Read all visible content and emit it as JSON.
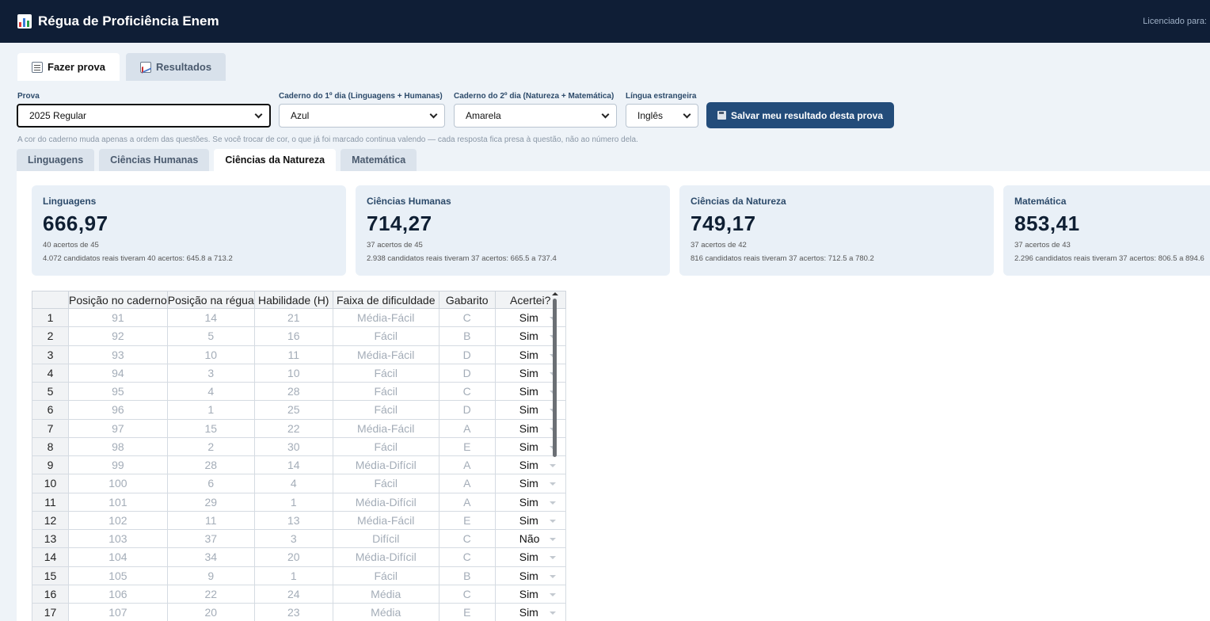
{
  "app": {
    "title": "Régua de Proficiência Enem",
    "license": "Licenciado para:"
  },
  "main_tabs": [
    {
      "label": "Fazer prova",
      "icon": "memo-icon"
    },
    {
      "label": "Resultados",
      "icon": "chart-icon"
    }
  ],
  "form": {
    "prova_label": "Prova",
    "prova_value": "2025 Regular",
    "caderno1_label": "Caderno do 1º dia (Linguagens + Humanas)",
    "caderno1_value": "Azul",
    "caderno2_label": "Caderno do 2º dia (Natureza + Matemática)",
    "caderno2_value": "Amarela",
    "lingua_label": "Língua estrangeira",
    "lingua_value": "Inglês",
    "save_label": "Salvar meu resultado desta prova",
    "hint": "A cor do caderno muda apenas a ordem das questões. Se você trocar de cor, o que já foi marcado continua valendo — cada resposta fica presa à questão, não ao número dela."
  },
  "sub_tabs": [
    "Linguagens",
    "Ciências Humanas",
    "Ciências da Natureza",
    "Matemática"
  ],
  "active_sub_tab": "Ciências da Natureza",
  "cards": [
    {
      "title": "Linguagens",
      "score": "666,97",
      "hits": "40 acertos de 45",
      "range": "4.072 candidatos reais tiveram 40 acertos: 645.8 a 713.2"
    },
    {
      "title": "Ciências Humanas",
      "score": "714,27",
      "hits": "37 acertos de 45",
      "range": "2.938 candidatos reais tiveram 37 acertos: 665.5 a 737.4"
    },
    {
      "title": "Ciências da Natureza",
      "score": "749,17",
      "hits": "37 acertos de 42",
      "range": "816 candidatos reais tiveram 37 acertos: 712.5 a 780.2"
    },
    {
      "title": "Matemática",
      "score": "853,41",
      "hits": "37 acertos de 43",
      "range": "2.296 candidatos reais tiveram 37 acertos: 806.5 a 894.6"
    }
  ],
  "table": {
    "headers": [
      "",
      "Posição no caderno",
      "Posição na régua",
      "Habilidade (H)",
      "Faixa de dificuldade",
      "Gabarito",
      "Acertei?"
    ],
    "rows": [
      [
        "1",
        "91",
        "14",
        "21",
        "Média-Fácil",
        "C",
        "Sim"
      ],
      [
        "2",
        "92",
        "5",
        "16",
        "Fácil",
        "B",
        "Sim"
      ],
      [
        "3",
        "93",
        "10",
        "11",
        "Média-Fácil",
        "D",
        "Sim"
      ],
      [
        "4",
        "94",
        "3",
        "10",
        "Fácil",
        "D",
        "Sim"
      ],
      [
        "5",
        "95",
        "4",
        "28",
        "Fácil",
        "C",
        "Sim"
      ],
      [
        "6",
        "96",
        "1",
        "25",
        "Fácil",
        "D",
        "Sim"
      ],
      [
        "7",
        "97",
        "15",
        "22",
        "Média-Fácil",
        "A",
        "Sim"
      ],
      [
        "8",
        "98",
        "2",
        "30",
        "Fácil",
        "E",
        "Sim"
      ],
      [
        "9",
        "99",
        "28",
        "14",
        "Média-Difícil",
        "A",
        "Sim"
      ],
      [
        "10",
        "100",
        "6",
        "4",
        "Fácil",
        "A",
        "Sim"
      ],
      [
        "11",
        "101",
        "29",
        "1",
        "Média-Difícil",
        "A",
        "Sim"
      ],
      [
        "12",
        "102",
        "11",
        "13",
        "Média-Fácil",
        "E",
        "Sim"
      ],
      [
        "13",
        "103",
        "37",
        "3",
        "Difícil",
        "C",
        "Não"
      ],
      [
        "14",
        "104",
        "34",
        "20",
        "Média-Difícil",
        "C",
        "Sim"
      ],
      [
        "15",
        "105",
        "9",
        "1",
        "Fácil",
        "B",
        "Sim"
      ],
      [
        "16",
        "106",
        "22",
        "24",
        "Média",
        "C",
        "Sim"
      ],
      [
        "17",
        "107",
        "20",
        "23",
        "Média",
        "E",
        "Sim"
      ]
    ]
  }
}
